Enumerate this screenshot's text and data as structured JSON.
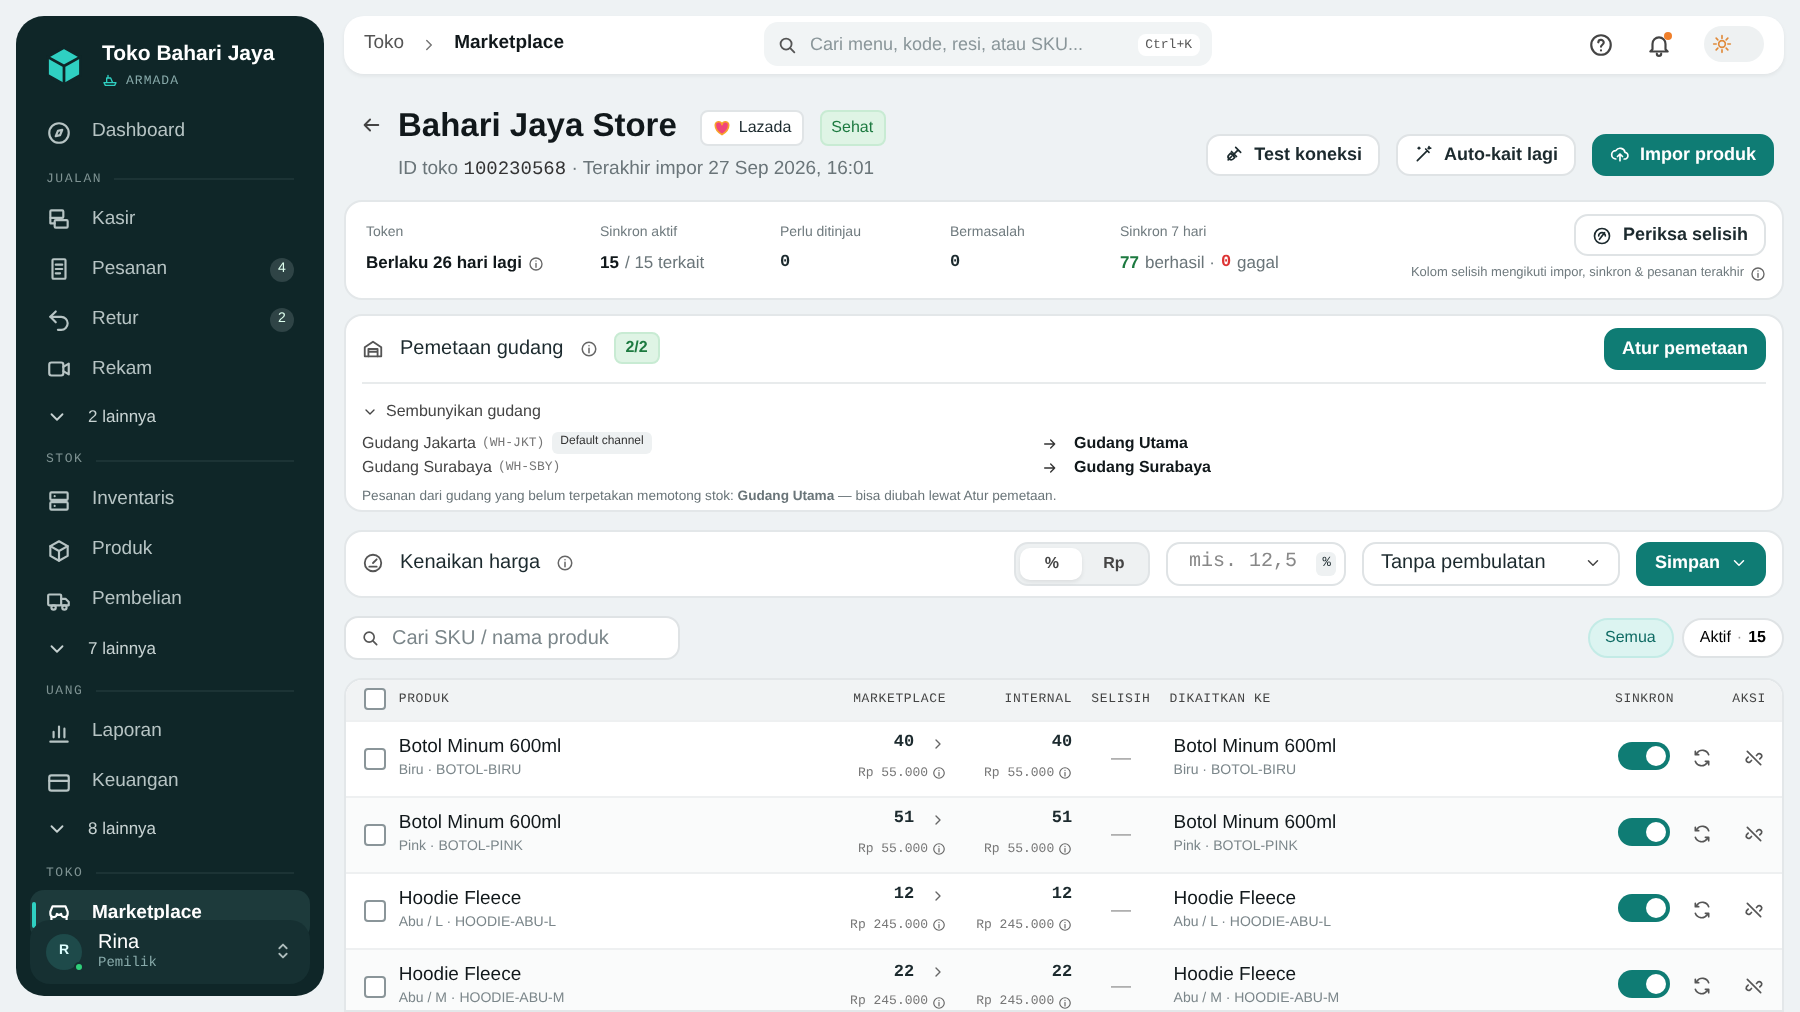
{
  "sidebar": {
    "brand": {
      "name": "Toko Bahari Jaya",
      "sub": "ARMADA"
    },
    "sections": [
      {
        "items": [
          {
            "kind": "link",
            "label": "Dashboard",
            "selected": false
          }
        ]
      },
      {
        "label": "JUALAN",
        "items": [
          {
            "kind": "link",
            "label": "Kasir",
            "selected": false
          },
          {
            "kind": "link",
            "label": "Pesanan",
            "badge": "4",
            "selected": false
          },
          {
            "kind": "link",
            "label": "Retur",
            "badge": "2",
            "selected": false
          },
          {
            "kind": "link",
            "label": "Rekam",
            "selected": false
          },
          {
            "kind": "more",
            "label": "2 lainnya",
            "selected": false
          }
        ]
      },
      {
        "label": "STOK",
        "items": [
          {
            "kind": "link",
            "label": "Inventaris",
            "selected": false
          },
          {
            "kind": "link",
            "label": "Produk",
            "selected": false
          },
          {
            "kind": "link",
            "label": "Pembelian",
            "selected": false
          },
          {
            "kind": "more",
            "label": "7 lainnya",
            "selected": false
          }
        ]
      },
      {
        "label": "UANG",
        "items": [
          {
            "kind": "link",
            "label": "Laporan",
            "selected": false
          },
          {
            "kind": "link",
            "label": "Keuangan",
            "selected": false
          },
          {
            "kind": "more",
            "label": "8 lainnya",
            "selected": false
          }
        ]
      },
      {
        "label": "TOKO",
        "items": [
          {
            "kind": "link",
            "label": "Marketplace",
            "selected": true
          }
        ]
      }
    ],
    "user": {
      "initial": "R",
      "name": "Rina",
      "role": "Pemilik",
      "online": true
    }
  },
  "topbar": {
    "breadcrumb": [
      "Toko",
      "Marketplace"
    ],
    "search": {
      "placeholder": "Cari menu, kode, resi, atau SKU...",
      "shortcut": "Ctrl+K"
    },
    "notification": true,
    "dark_mode": false
  },
  "header": {
    "title": "Bahari Jaya Store",
    "badges": [
      {
        "kind": "channel",
        "label": "Lazada"
      },
      {
        "kind": "status",
        "label": "Sehat"
      }
    ],
    "id_label": "ID toko",
    "id": "100230568",
    "meta": "· Terakhir impor 27 Sep 2026, 16:01",
    "buttons": [
      {
        "kind": "outline",
        "label": "Test koneksi"
      },
      {
        "kind": "outline",
        "label": "Auto-kait lagi"
      },
      {
        "kind": "primary",
        "label": "Impor produk"
      }
    ]
  },
  "stats": {
    "items": [
      {
        "label": "Token",
        "info": true,
        "value": [
          {
            "kind": "strong",
            "text": "Berlaku 26 hari lagi"
          }
        ]
      },
      {
        "label": "Sinkron aktif",
        "value": [
          {
            "kind": "strong",
            "text": "15"
          },
          {
            "kind": "muted",
            "text": "/ 15 terkait"
          }
        ]
      },
      {
        "label": "Perlu ditinjau",
        "value": [
          {
            "kind": "mono",
            "text": "0"
          }
        ]
      },
      {
        "label": "Bermasalah",
        "value": [
          {
            "kind": "mono",
            "text": "0"
          }
        ]
      },
      {
        "label": "Sinkron 7 hari",
        "value": [
          {
            "kind": "success",
            "text": "77"
          },
          {
            "kind": "muted",
            "text": "berhasil ·"
          },
          {
            "kind": "danger",
            "text": "0"
          },
          {
            "kind": "muted",
            "text": "gagal"
          }
        ]
      }
    ],
    "button": "Periksa selisih",
    "note": "Kolom selisih mengikuti impor, sinkron & pesanan terakhir"
  },
  "mapping": {
    "title": "Pemetaan gudang",
    "count": "2/2",
    "button": "Atur pemetaan",
    "toggle": "Sembunyikan gudang",
    "expanded": true,
    "rows": [
      {
        "source": "Gudang Jakarta",
        "code": "(WH-JKT)",
        "tag": "Default channel",
        "target": "Gudang Utama"
      },
      {
        "source": "Gudang Surabaya",
        "code": "(WH-SBY)",
        "target": "Gudang Surabaya"
      }
    ],
    "note": "Pesanan dari gudang yang belum terpetakan memotong stok: **Gudang Utama** — bisa diubah lewat Atur pemetaan."
  },
  "pricing": {
    "title": "Kenaikan harga",
    "modes": [
      {
        "label": "%",
        "selected": true
      },
      {
        "label": "Rp",
        "selected": false
      }
    ],
    "placeholder": "mis. 12,5",
    "suffix": "%",
    "rounding": "Tanpa pembulatan",
    "save": "Simpan"
  },
  "filter": {
    "placeholder": "Cari SKU / nama produk",
    "chips": [
      {
        "label": "Semua",
        "selected": true
      },
      {
        "label": "Aktif",
        "separator": "·",
        "count": "15",
        "selected": false
      }
    ]
  },
  "table": {
    "select_all": false,
    "columns": [
      "PRODUK",
      "MARKETPLACE",
      "INTERNAL",
      "SELISIH",
      "DIKAITKAN KE",
      "SINKRON",
      "AKSI"
    ],
    "rows": [
      {
        "checked": false,
        "name": "Botol Minum 600ml",
        "variant": "Biru · BOTOL-BIRU",
        "mp_qty": "40",
        "mp_price": "Rp 55.000",
        "int_qty": "40",
        "int_price": "Rp 55.000",
        "diff": "—",
        "linked_name": "Botol Minum 600ml",
        "linked_variant": "Biru · BOTOL-BIRU",
        "sync": true
      },
      {
        "checked": false,
        "name": "Botol Minum 600ml",
        "variant": "Pink · BOTOL-PINK",
        "mp_qty": "51",
        "mp_price": "Rp 55.000",
        "int_qty": "51",
        "int_price": "Rp 55.000",
        "diff": "—",
        "linked_name": "Botol Minum 600ml",
        "linked_variant": "Pink · BOTOL-PINK",
        "sync": true
      },
      {
        "checked": false,
        "name": "Hoodie Fleece",
        "variant": "Abu / L · HOODIE-ABU-L",
        "mp_qty": "12",
        "mp_price": "Rp 245.000",
        "int_qty": "12",
        "int_price": "Rp 245.000",
        "diff": "—",
        "linked_name": "Hoodie Fleece",
        "linked_variant": "Abu / L · HOODIE-ABU-L",
        "sync": true
      },
      {
        "checked": false,
        "name": "Hoodie Fleece",
        "variant": "Abu / M · HOODIE-ABU-M",
        "mp_qty": "22",
        "mp_price": "Rp 245.000",
        "int_qty": "22",
        "int_price": "Rp 245.000",
        "diff": "—",
        "linked_name": "Hoodie Fleece",
        "linked_variant": "Abu / M · HOODIE-ABU-M",
        "sync": true
      }
    ]
  }
}
